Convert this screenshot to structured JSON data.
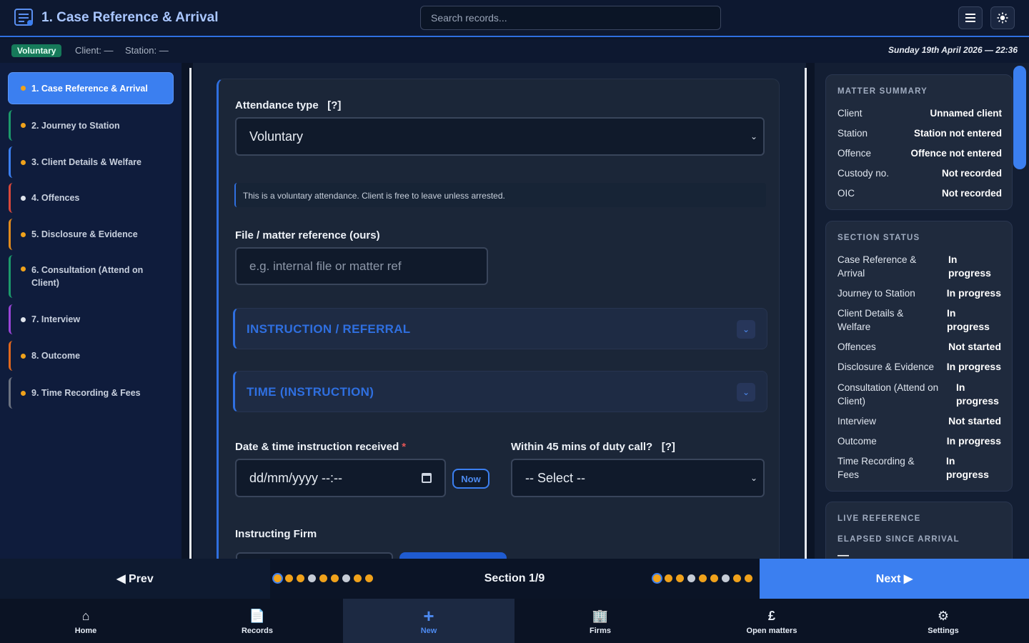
{
  "header": {
    "title": "1. Case Reference & Arrival",
    "search_placeholder": "Search records...",
    "menu_icon": "hamburger-icon",
    "theme_icon": "sun-icon"
  },
  "status": {
    "badge": "Voluntary",
    "client": "Client: —",
    "station": "Station: —",
    "datetime": "Sunday 19th April 2026 — 22:36"
  },
  "sidebar": {
    "items": [
      {
        "label": "1. Case Reference & Arrival",
        "accent": "#3b7ff0",
        "active": true
      },
      {
        "label": "2. Journey to Station",
        "accent": "#1c9a6b"
      },
      {
        "label": "3. Client Details & Welfare",
        "accent": "#3b7ff0"
      },
      {
        "label": "4. Offences",
        "accent": "#d9483b"
      },
      {
        "label": "5. Disclosure & Evidence",
        "accent": "#e08a1e"
      },
      {
        "label": "6. Consultation (Attend on Client)",
        "accent": "#1c9a6b"
      },
      {
        "label": "7. Interview",
        "accent": "#9a45d8"
      },
      {
        "label": "8. Outcome",
        "accent": "#e0671e"
      },
      {
        "label": "9. Time Recording & Fees",
        "accent": "#6b7280"
      }
    ]
  },
  "form": {
    "attendance_label": "Attendance type",
    "help_marker": "[?]",
    "attendance_value": "Voluntary",
    "info_text": "This is a voluntary attendance. Client is free to leave unless arrested.",
    "fileref_label": "File / matter reference (ours)",
    "fileref_placeholder": "e.g. internal file or matter ref",
    "accordion1": "INSTRUCTION / REFERRAL",
    "accordion2": "TIME (INSTRUCTION)",
    "datetime_label": "Date & time instruction received",
    "required_marker": "*",
    "datetime_placeholder": "dd/mm/yyyy --:--",
    "now_button": "Now",
    "within_label": "Within 45 mins of duty call?",
    "within_value": "-- Select --",
    "firm_label": "Instructing Firm"
  },
  "summary": {
    "title": "MATTER SUMMARY",
    "rows": [
      {
        "k": "Client",
        "v": "Unnamed client"
      },
      {
        "k": "Station",
        "v": "Station not entered"
      },
      {
        "k": "Offence",
        "v": "Offence not entered"
      },
      {
        "k": "Custody no.",
        "v": "Not recorded"
      },
      {
        "k": "OIC",
        "v": "Not recorded"
      }
    ]
  },
  "section_status": {
    "title": "SECTION STATUS",
    "rows": [
      {
        "k1": "Case Reference &",
        "k2": "Arrival",
        "v1": "In",
        "v2": "progress"
      },
      {
        "k1": "Journey to Station",
        "v1": "In progress"
      },
      {
        "k1": "Client Details &",
        "k2": "Welfare",
        "v1": "In",
        "v2": "progress"
      },
      {
        "k1": "Offences",
        "v1": "Not started"
      },
      {
        "k1": "Disclosure & Evidence",
        "v1": "In progress"
      },
      {
        "k1": "Consultation (Attend on",
        "k2": "Client)",
        "v1": "In",
        "v2": "progress"
      },
      {
        "k1": "Interview",
        "v1": "Not started"
      },
      {
        "k1": "Outcome",
        "v1": "In progress"
      },
      {
        "k1": "Time Recording &",
        "k2": "Fees",
        "v1": "In",
        "v2": "progress"
      }
    ]
  },
  "live": {
    "title": "LIVE REFERENCE",
    "elapsed": "ELAPSED SINCE ARRIVAL",
    "elapsed_value": "—"
  },
  "pager": {
    "prev": "◀ Prev",
    "next": "Next ▶",
    "section": "Section 1/9",
    "dot_states": [
      "progress",
      "progress",
      "progress",
      "not-started",
      "progress",
      "progress",
      "not-started",
      "progress",
      "progress"
    ],
    "current_index": 0,
    "progress_color": "#f0a21b",
    "not_started_color": "#c6ccd6"
  },
  "tabs": [
    {
      "label": "Home",
      "icon": "home-icon",
      "glyph": "⌂"
    },
    {
      "label": "Records",
      "icon": "document-icon",
      "glyph": "📄"
    },
    {
      "label": "New",
      "icon": "plus-icon",
      "glyph": "+",
      "active": true
    },
    {
      "label": "Firms",
      "icon": "building-icon",
      "glyph": "🏢"
    },
    {
      "label": "Open matters",
      "icon": "pound-icon",
      "glyph": "£"
    },
    {
      "label": "Settings",
      "icon": "gear-icon",
      "glyph": "⚙"
    }
  ]
}
